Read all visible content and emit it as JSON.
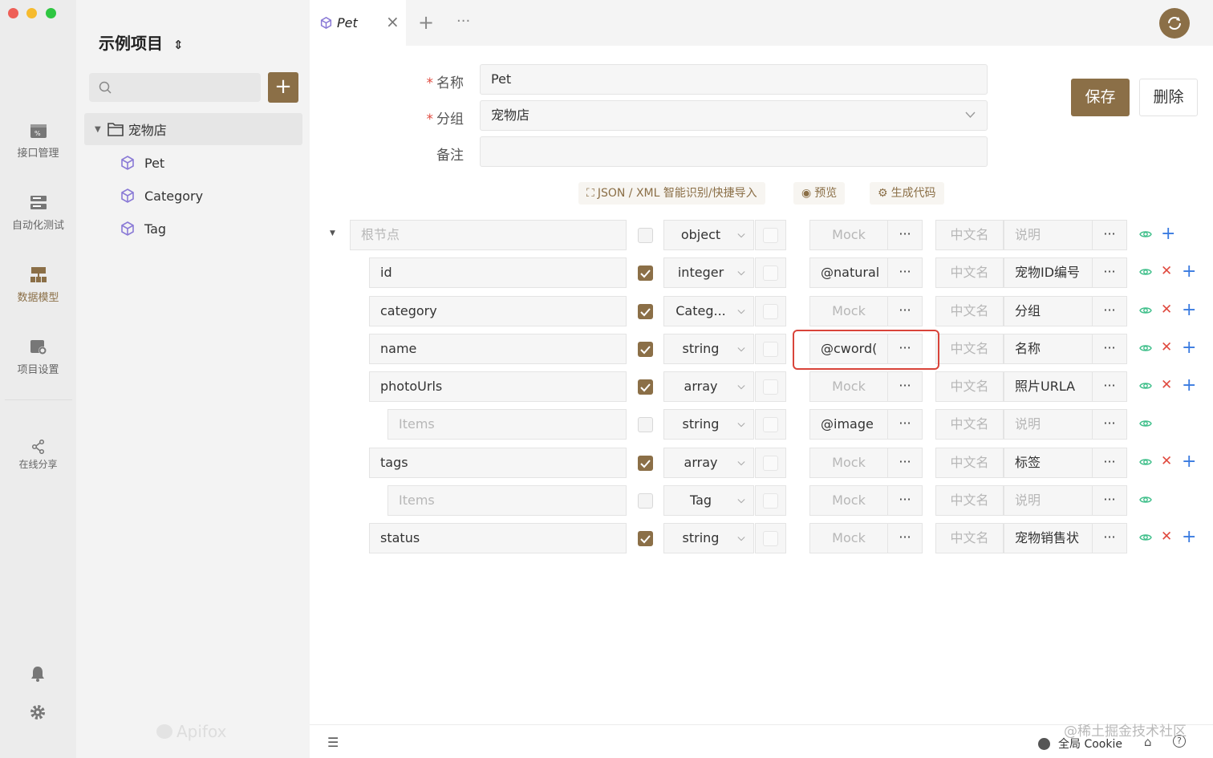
{
  "rail": {
    "items": [
      {
        "label": "接口管理",
        "icon": "api-icon",
        "active": false
      },
      {
        "label": "自动化测试",
        "icon": "test-icon",
        "active": false
      },
      {
        "label": "数据模型",
        "icon": "model-icon",
        "active": true
      },
      {
        "label": "项目设置",
        "icon": "settings-gear-icon",
        "active": false
      },
      {
        "label": "在线分享",
        "icon": "share-icon",
        "active": false
      }
    ]
  },
  "sidebar": {
    "project_name": "示例项目",
    "search_placeholder": "",
    "folder": "宠物店",
    "models": [
      "Pet",
      "Category",
      "Tag"
    ],
    "brand": "Apifox"
  },
  "tab": {
    "title": "Pet"
  },
  "form": {
    "name_label": "名称",
    "name_value": "Pet",
    "group_label": "分组",
    "group_value": "宠物店",
    "note_label": "备注",
    "note_value": "",
    "save": "保存",
    "delete": "删除"
  },
  "tools": [
    "JSON / XML 智能识别/快捷导入",
    "预览",
    "生成代码"
  ],
  "schema": {
    "rows": [
      {
        "name": "根节点",
        "name_ph": true,
        "indent": 0,
        "required": false,
        "type": "object",
        "mock": "Mock",
        "mock_ph": true,
        "cn": "中文名",
        "desc": "说明",
        "desc_ph": true,
        "actions": [
          "eye",
          "add"
        ]
      },
      {
        "name": "id",
        "name_ph": false,
        "indent": 1,
        "required": true,
        "type": "integer",
        "mock": "@natural",
        "mock_ph": false,
        "cn": "中文名",
        "desc": "宠物ID编号",
        "desc_ph": false,
        "actions": [
          "eye",
          "del",
          "add"
        ]
      },
      {
        "name": "category",
        "name_ph": false,
        "indent": 1,
        "required": true,
        "type": "Categ...",
        "mock": "Mock",
        "mock_ph": true,
        "cn": "中文名",
        "desc": "分组",
        "desc_ph": false,
        "actions": [
          "eye",
          "del",
          "add"
        ]
      },
      {
        "name": "name",
        "name_ph": false,
        "indent": 1,
        "required": true,
        "type": "string",
        "mock": "@cword(",
        "mock_ph": false,
        "cn": "中文名",
        "desc": "名称",
        "desc_ph": false,
        "actions": [
          "eye",
          "del",
          "add"
        ]
      },
      {
        "name": "photoUrls",
        "name_ph": false,
        "indent": 1,
        "required": true,
        "type": "array",
        "mock": "Mock",
        "mock_ph": true,
        "cn": "中文名",
        "desc": "照片URLA",
        "desc_ph": false,
        "actions": [
          "eye",
          "del",
          "add"
        ]
      },
      {
        "name": "Items",
        "name_ph": true,
        "indent": 2,
        "required": false,
        "type": "string",
        "mock": "@image",
        "mock_ph": false,
        "cn": "中文名",
        "desc": "说明",
        "desc_ph": true,
        "actions": [
          "eye"
        ]
      },
      {
        "name": "tags",
        "name_ph": false,
        "indent": 1,
        "required": true,
        "type": "array",
        "mock": "Mock",
        "mock_ph": true,
        "cn": "中文名",
        "desc": "标签",
        "desc_ph": false,
        "actions": [
          "eye",
          "del",
          "add"
        ]
      },
      {
        "name": "Items",
        "name_ph": true,
        "indent": 2,
        "required": false,
        "type": "Tag",
        "mock": "Mock",
        "mock_ph": true,
        "cn": "中文名",
        "desc": "说明",
        "desc_ph": true,
        "actions": [
          "eye"
        ]
      },
      {
        "name": "status",
        "name_ph": false,
        "indent": 1,
        "required": true,
        "type": "string",
        "mock": "Mock",
        "mock_ph": true,
        "cn": "中文名",
        "desc": "宠物销售状",
        "desc_ph": false,
        "actions": [
          "eye",
          "del",
          "add"
        ]
      }
    ]
  },
  "bottom": {
    "cookie": "全局 Cookie",
    "watermark": "@稀土掘金技术社区"
  },
  "colors": {
    "accent": "#8b6f47",
    "eye": "#3fbf8a",
    "delete": "#e04a3f",
    "add": "#3a7be0",
    "highlight": "#d9443a"
  }
}
